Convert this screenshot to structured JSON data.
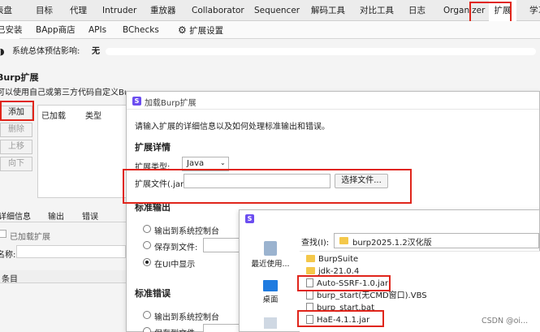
{
  "top_tabs": [
    {
      "label": "表盘",
      "active": false
    },
    {
      "label": "目标",
      "active": false
    },
    {
      "label": "代理",
      "active": false
    },
    {
      "label": "Intruder",
      "active": false
    },
    {
      "label": "重放器",
      "active": false
    },
    {
      "label": "Collaborator",
      "active": false
    },
    {
      "label": "Sequencer",
      "active": false
    },
    {
      "label": "解码工具",
      "active": false
    },
    {
      "label": "对比工具",
      "active": false
    },
    {
      "label": "日志",
      "active": false
    },
    {
      "label": "Organizer",
      "active": false
    },
    {
      "label": "扩展",
      "active": true
    },
    {
      "label": "学习",
      "active": false
    }
  ],
  "sub_tabs": [
    {
      "label": "已安装",
      "active": true
    },
    {
      "label": "BApp商店",
      "active": false
    },
    {
      "label": "APIs",
      "active": false
    },
    {
      "label": "BChecks",
      "active": false
    },
    {
      "label": "扩展设置",
      "active": false
    }
  ],
  "impact": {
    "label": "系统总体预估影响:",
    "value": "无"
  },
  "burp_ext": {
    "title": "Burp扩展",
    "desc": "可以使用自己或第三方代码自定义Burp的行为。",
    "buttons": {
      "add": "添加",
      "remove": "删除",
      "up": "上移",
      "down": "向下"
    },
    "columns": {
      "loaded": "已加载",
      "type": "类型"
    }
  },
  "detail_tabs": {
    "details": "详细信息",
    "output": "输出",
    "errors": "错误"
  },
  "detail": {
    "loaded_checkbox": "已加载扩展",
    "name_label": "名称:",
    "entries_label": "条目"
  },
  "dialog": {
    "title": "加载Burp扩展",
    "intro": "请输入扩展的详细信息以及如何处理标准输出和错误。",
    "details_title": "扩展详情",
    "type_label": "扩展类型:",
    "type_value": "Java",
    "file_label": "扩展文件(.jar)",
    "file_value": "",
    "select_button": "选择文件...",
    "stdout_title": "标准输出",
    "stderr_title": "标准错误",
    "opt_console": "输出到系统控制台",
    "opt_file": "保存到文件:",
    "opt_ui": "在UI中显示"
  },
  "file_dialog": {
    "lookin_label": "查找(I):",
    "lookin_value": "burp2025.1.2汉化版",
    "places": {
      "recent": "最近使用...",
      "desktop": "桌面"
    },
    "files": [
      {
        "name": "BurpSuite",
        "kind": "folder"
      },
      {
        "name": "jdk-21.0.4",
        "kind": "folder"
      },
      {
        "name": "Auto-SSRF-1.0.jar",
        "kind": "file"
      },
      {
        "name": "burp_start(无CMD窗口).VBS",
        "kind": "file"
      },
      {
        "name": "burp_start.bat",
        "kind": "file"
      },
      {
        "name": "HaE-4.1.1.jar",
        "kind": "file"
      }
    ]
  },
  "watermark": "CSDN @oi...",
  "colors": {
    "highlight": "#e0251b",
    "accent": "#6b4df0"
  }
}
